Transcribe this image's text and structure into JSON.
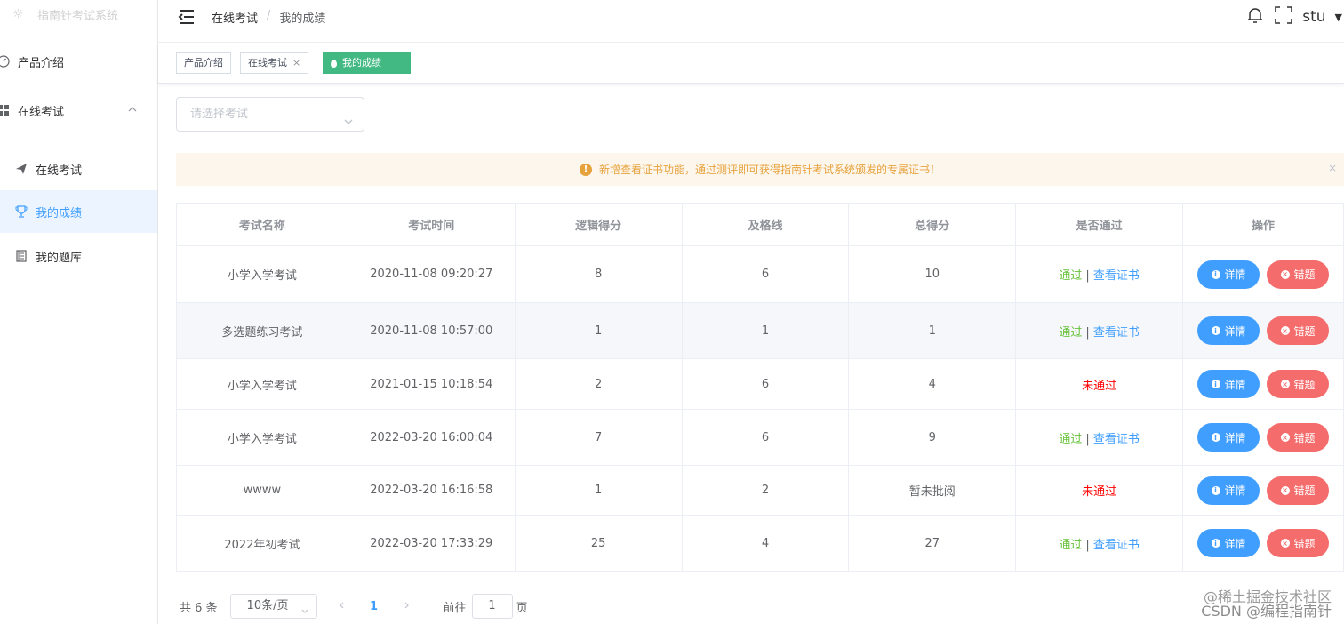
{
  "app": {
    "title": "指南针考试系统"
  },
  "sidebar": {
    "items": [
      {
        "label": "产品介绍"
      },
      {
        "label": "在线考试"
      },
      {
        "label": "在线考试"
      },
      {
        "label": "我的成绩"
      },
      {
        "label": "我的题库"
      }
    ]
  },
  "header": {
    "breadcrumb": [
      "在线考试",
      "/",
      "我的成绩"
    ],
    "user": "stu"
  },
  "tags": [
    {
      "label": "产品介绍"
    },
    {
      "label": "在线考试",
      "close": "×"
    },
    {
      "label": "我的成绩"
    }
  ],
  "filter": {
    "placeholder": "请选择考试"
  },
  "alert": {
    "text": "新增查看证书功能，通过测评即可获得指南针考试系统颁发的专属证书！",
    "close": "×"
  },
  "table": {
    "headers": [
      "考试名称",
      "考试时间",
      "逻辑得分",
      "及格线",
      "总得分",
      "是否通过",
      "操作"
    ],
    "rows": [
      {
        "name": "小学入学考试",
        "time": "2020-11-08 09:20:27",
        "logic": "8",
        "pass_line": "6",
        "total": "10",
        "status": "通过",
        "cert": "查看证书"
      },
      {
        "name": "多选题练习考试",
        "time": "2020-11-08 10:57:00",
        "logic": "1",
        "pass_line": "1",
        "total": "1",
        "status": "通过",
        "cert": "查看证书"
      },
      {
        "name": "小学入学考试",
        "time": "2021-01-15 10:18:54",
        "logic": "2",
        "pass_line": "6",
        "total": "4",
        "status": "未通过",
        "cert": ""
      },
      {
        "name": "小学入学考试",
        "time": "2022-03-20 16:00:04",
        "logic": "7",
        "pass_line": "6",
        "total": "9",
        "status": "通过",
        "cert": "查看证书"
      },
      {
        "name": "wwww",
        "time": "2022-03-20 16:16:58",
        "logic": "1",
        "pass_line": "2",
        "total": "暂未批阅",
        "status": "未通过",
        "cert": ""
      },
      {
        "name": "2022年初考试",
        "time": "2022-03-20 17:33:29",
        "logic": "25",
        "pass_line": "4",
        "total": "27",
        "status": "通过",
        "cert": "查看证书"
      }
    ],
    "actions": {
      "detail": "详情",
      "wrong": "错题",
      "separator": "|"
    }
  },
  "pagination": {
    "total": "共 6 条",
    "page_size": "10条/页",
    "current_page": "1",
    "goto_label": "前往",
    "goto_value": "1",
    "page_suffix": "页"
  },
  "watermark": {
    "line1": "@稀土掘金技术社区",
    "line2": "CSDN @编程指南针"
  },
  "colors": {
    "primary": "#409eff",
    "success": "#67c23a",
    "danger": "#f56c6c",
    "warning": "#e6a23c",
    "tag_active": "#42b983"
  }
}
